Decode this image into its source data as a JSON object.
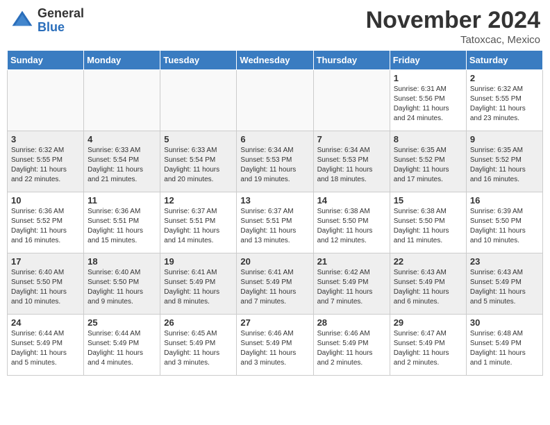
{
  "header": {
    "logo_general": "General",
    "logo_blue": "Blue",
    "month_title": "November 2024",
    "subtitle": "Tatoxcac, Mexico"
  },
  "days_of_week": [
    "Sunday",
    "Monday",
    "Tuesday",
    "Wednesday",
    "Thursday",
    "Friday",
    "Saturday"
  ],
  "weeks": [
    [
      {
        "day": "",
        "info": ""
      },
      {
        "day": "",
        "info": ""
      },
      {
        "day": "",
        "info": ""
      },
      {
        "day": "",
        "info": ""
      },
      {
        "day": "",
        "info": ""
      },
      {
        "day": "1",
        "info": "Sunrise: 6:31 AM\nSunset: 5:56 PM\nDaylight: 11 hours and 24 minutes."
      },
      {
        "day": "2",
        "info": "Sunrise: 6:32 AM\nSunset: 5:55 PM\nDaylight: 11 hours and 23 minutes."
      }
    ],
    [
      {
        "day": "3",
        "info": "Sunrise: 6:32 AM\nSunset: 5:55 PM\nDaylight: 11 hours and 22 minutes."
      },
      {
        "day": "4",
        "info": "Sunrise: 6:33 AM\nSunset: 5:54 PM\nDaylight: 11 hours and 21 minutes."
      },
      {
        "day": "5",
        "info": "Sunrise: 6:33 AM\nSunset: 5:54 PM\nDaylight: 11 hours and 20 minutes."
      },
      {
        "day": "6",
        "info": "Sunrise: 6:34 AM\nSunset: 5:53 PM\nDaylight: 11 hours and 19 minutes."
      },
      {
        "day": "7",
        "info": "Sunrise: 6:34 AM\nSunset: 5:53 PM\nDaylight: 11 hours and 18 minutes."
      },
      {
        "day": "8",
        "info": "Sunrise: 6:35 AM\nSunset: 5:52 PM\nDaylight: 11 hours and 17 minutes."
      },
      {
        "day": "9",
        "info": "Sunrise: 6:35 AM\nSunset: 5:52 PM\nDaylight: 11 hours and 16 minutes."
      }
    ],
    [
      {
        "day": "10",
        "info": "Sunrise: 6:36 AM\nSunset: 5:52 PM\nDaylight: 11 hours and 16 minutes."
      },
      {
        "day": "11",
        "info": "Sunrise: 6:36 AM\nSunset: 5:51 PM\nDaylight: 11 hours and 15 minutes."
      },
      {
        "day": "12",
        "info": "Sunrise: 6:37 AM\nSunset: 5:51 PM\nDaylight: 11 hours and 14 minutes."
      },
      {
        "day": "13",
        "info": "Sunrise: 6:37 AM\nSunset: 5:51 PM\nDaylight: 11 hours and 13 minutes."
      },
      {
        "day": "14",
        "info": "Sunrise: 6:38 AM\nSunset: 5:50 PM\nDaylight: 11 hours and 12 minutes."
      },
      {
        "day": "15",
        "info": "Sunrise: 6:38 AM\nSunset: 5:50 PM\nDaylight: 11 hours and 11 minutes."
      },
      {
        "day": "16",
        "info": "Sunrise: 6:39 AM\nSunset: 5:50 PM\nDaylight: 11 hours and 10 minutes."
      }
    ],
    [
      {
        "day": "17",
        "info": "Sunrise: 6:40 AM\nSunset: 5:50 PM\nDaylight: 11 hours and 10 minutes."
      },
      {
        "day": "18",
        "info": "Sunrise: 6:40 AM\nSunset: 5:50 PM\nDaylight: 11 hours and 9 minutes."
      },
      {
        "day": "19",
        "info": "Sunrise: 6:41 AM\nSunset: 5:49 PM\nDaylight: 11 hours and 8 minutes."
      },
      {
        "day": "20",
        "info": "Sunrise: 6:41 AM\nSunset: 5:49 PM\nDaylight: 11 hours and 7 minutes."
      },
      {
        "day": "21",
        "info": "Sunrise: 6:42 AM\nSunset: 5:49 PM\nDaylight: 11 hours and 7 minutes."
      },
      {
        "day": "22",
        "info": "Sunrise: 6:43 AM\nSunset: 5:49 PM\nDaylight: 11 hours and 6 minutes."
      },
      {
        "day": "23",
        "info": "Sunrise: 6:43 AM\nSunset: 5:49 PM\nDaylight: 11 hours and 5 minutes."
      }
    ],
    [
      {
        "day": "24",
        "info": "Sunrise: 6:44 AM\nSunset: 5:49 PM\nDaylight: 11 hours and 5 minutes."
      },
      {
        "day": "25",
        "info": "Sunrise: 6:44 AM\nSunset: 5:49 PM\nDaylight: 11 hours and 4 minutes."
      },
      {
        "day": "26",
        "info": "Sunrise: 6:45 AM\nSunset: 5:49 PM\nDaylight: 11 hours and 3 minutes."
      },
      {
        "day": "27",
        "info": "Sunrise: 6:46 AM\nSunset: 5:49 PM\nDaylight: 11 hours and 3 minutes."
      },
      {
        "day": "28",
        "info": "Sunrise: 6:46 AM\nSunset: 5:49 PM\nDaylight: 11 hours and 2 minutes."
      },
      {
        "day": "29",
        "info": "Sunrise: 6:47 AM\nSunset: 5:49 PM\nDaylight: 11 hours and 2 minutes."
      },
      {
        "day": "30",
        "info": "Sunrise: 6:48 AM\nSunset: 5:49 PM\nDaylight: 11 hours and 1 minute."
      }
    ]
  ]
}
